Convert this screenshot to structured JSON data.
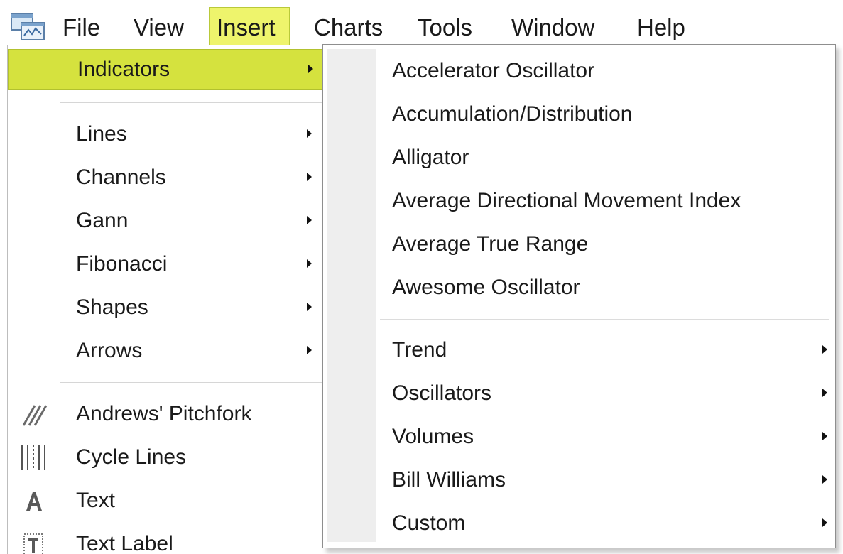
{
  "menubar": {
    "items": [
      {
        "label": "File"
      },
      {
        "label": "View"
      },
      {
        "label": "Insert",
        "active": true
      },
      {
        "label": "Charts"
      },
      {
        "label": "Tools"
      },
      {
        "label": "Window"
      },
      {
        "label": "Help"
      }
    ],
    "app_icon": "chart-window-icon"
  },
  "insert_menu": {
    "items": [
      {
        "label": "Indicators",
        "has_submenu": true,
        "highlighted": true
      },
      {
        "label": "Lines",
        "has_submenu": true
      },
      {
        "label": "Channels",
        "has_submenu": true
      },
      {
        "label": "Gann",
        "has_submenu": true
      },
      {
        "label": "Fibonacci",
        "has_submenu": true
      },
      {
        "label": "Shapes",
        "has_submenu": true
      },
      {
        "label": "Arrows",
        "has_submenu": true
      },
      {
        "label": "Andrews' Pitchfork",
        "icon": "pitchfork-icon"
      },
      {
        "label": "Cycle Lines",
        "icon": "cycle-lines-icon"
      },
      {
        "label": "Text",
        "icon": "text-a-icon"
      },
      {
        "label": "Text Label",
        "icon": "text-label-icon"
      }
    ]
  },
  "indicators_submenu": {
    "items": [
      {
        "label": "Accelerator Oscillator"
      },
      {
        "label": "Accumulation/Distribution"
      },
      {
        "label": "Alligator"
      },
      {
        "label": "Average Directional Movement Index"
      },
      {
        "label": "Average True Range"
      },
      {
        "label": "Awesome Oscillator"
      },
      {
        "label": "Trend",
        "has_submenu": true
      },
      {
        "label": "Oscillators",
        "has_submenu": true
      },
      {
        "label": "Volumes",
        "has_submenu": true
      },
      {
        "label": "Bill Williams",
        "has_submenu": true
      },
      {
        "label": "Custom",
        "has_submenu": true
      }
    ]
  },
  "colors": {
    "highlight": "#d5e23e",
    "active_menu": "#eef46c",
    "gutter": "#eeeeee"
  }
}
